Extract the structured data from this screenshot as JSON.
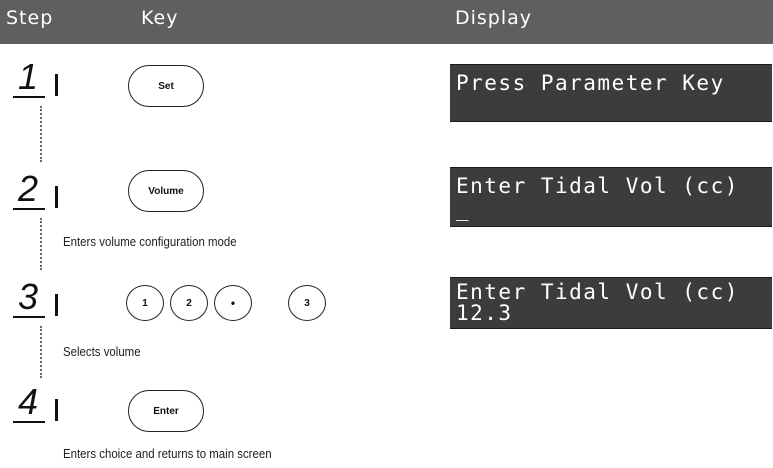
{
  "header": {
    "col_step": "Step",
    "col_key": "Key",
    "col_display": "Display"
  },
  "steps": [
    {
      "number": "1",
      "keys": [
        "Set"
      ],
      "display": [
        "Press Parameter Key",
        ""
      ],
      "caption": ""
    },
    {
      "number": "2",
      "keys": [
        "Volume"
      ],
      "display": [
        "Enter Tidal Vol (cc)",
        "_"
      ],
      "caption": "Enters volume configuration mode"
    },
    {
      "number": "3",
      "keys": [
        "1",
        "2",
        "•",
        "3"
      ],
      "display": [
        "Enter Tidal Vol (cc)",
        "12.3"
      ],
      "caption": "Selects volume"
    },
    {
      "number": "4",
      "keys": [
        "Enter"
      ],
      "display": [],
      "caption": "Enters choice and returns to main screen"
    }
  ],
  "colors": {
    "header_bg": "#5f5f5f",
    "display_bg": "#3c3c3c",
    "display_text": "#ffffff"
  }
}
